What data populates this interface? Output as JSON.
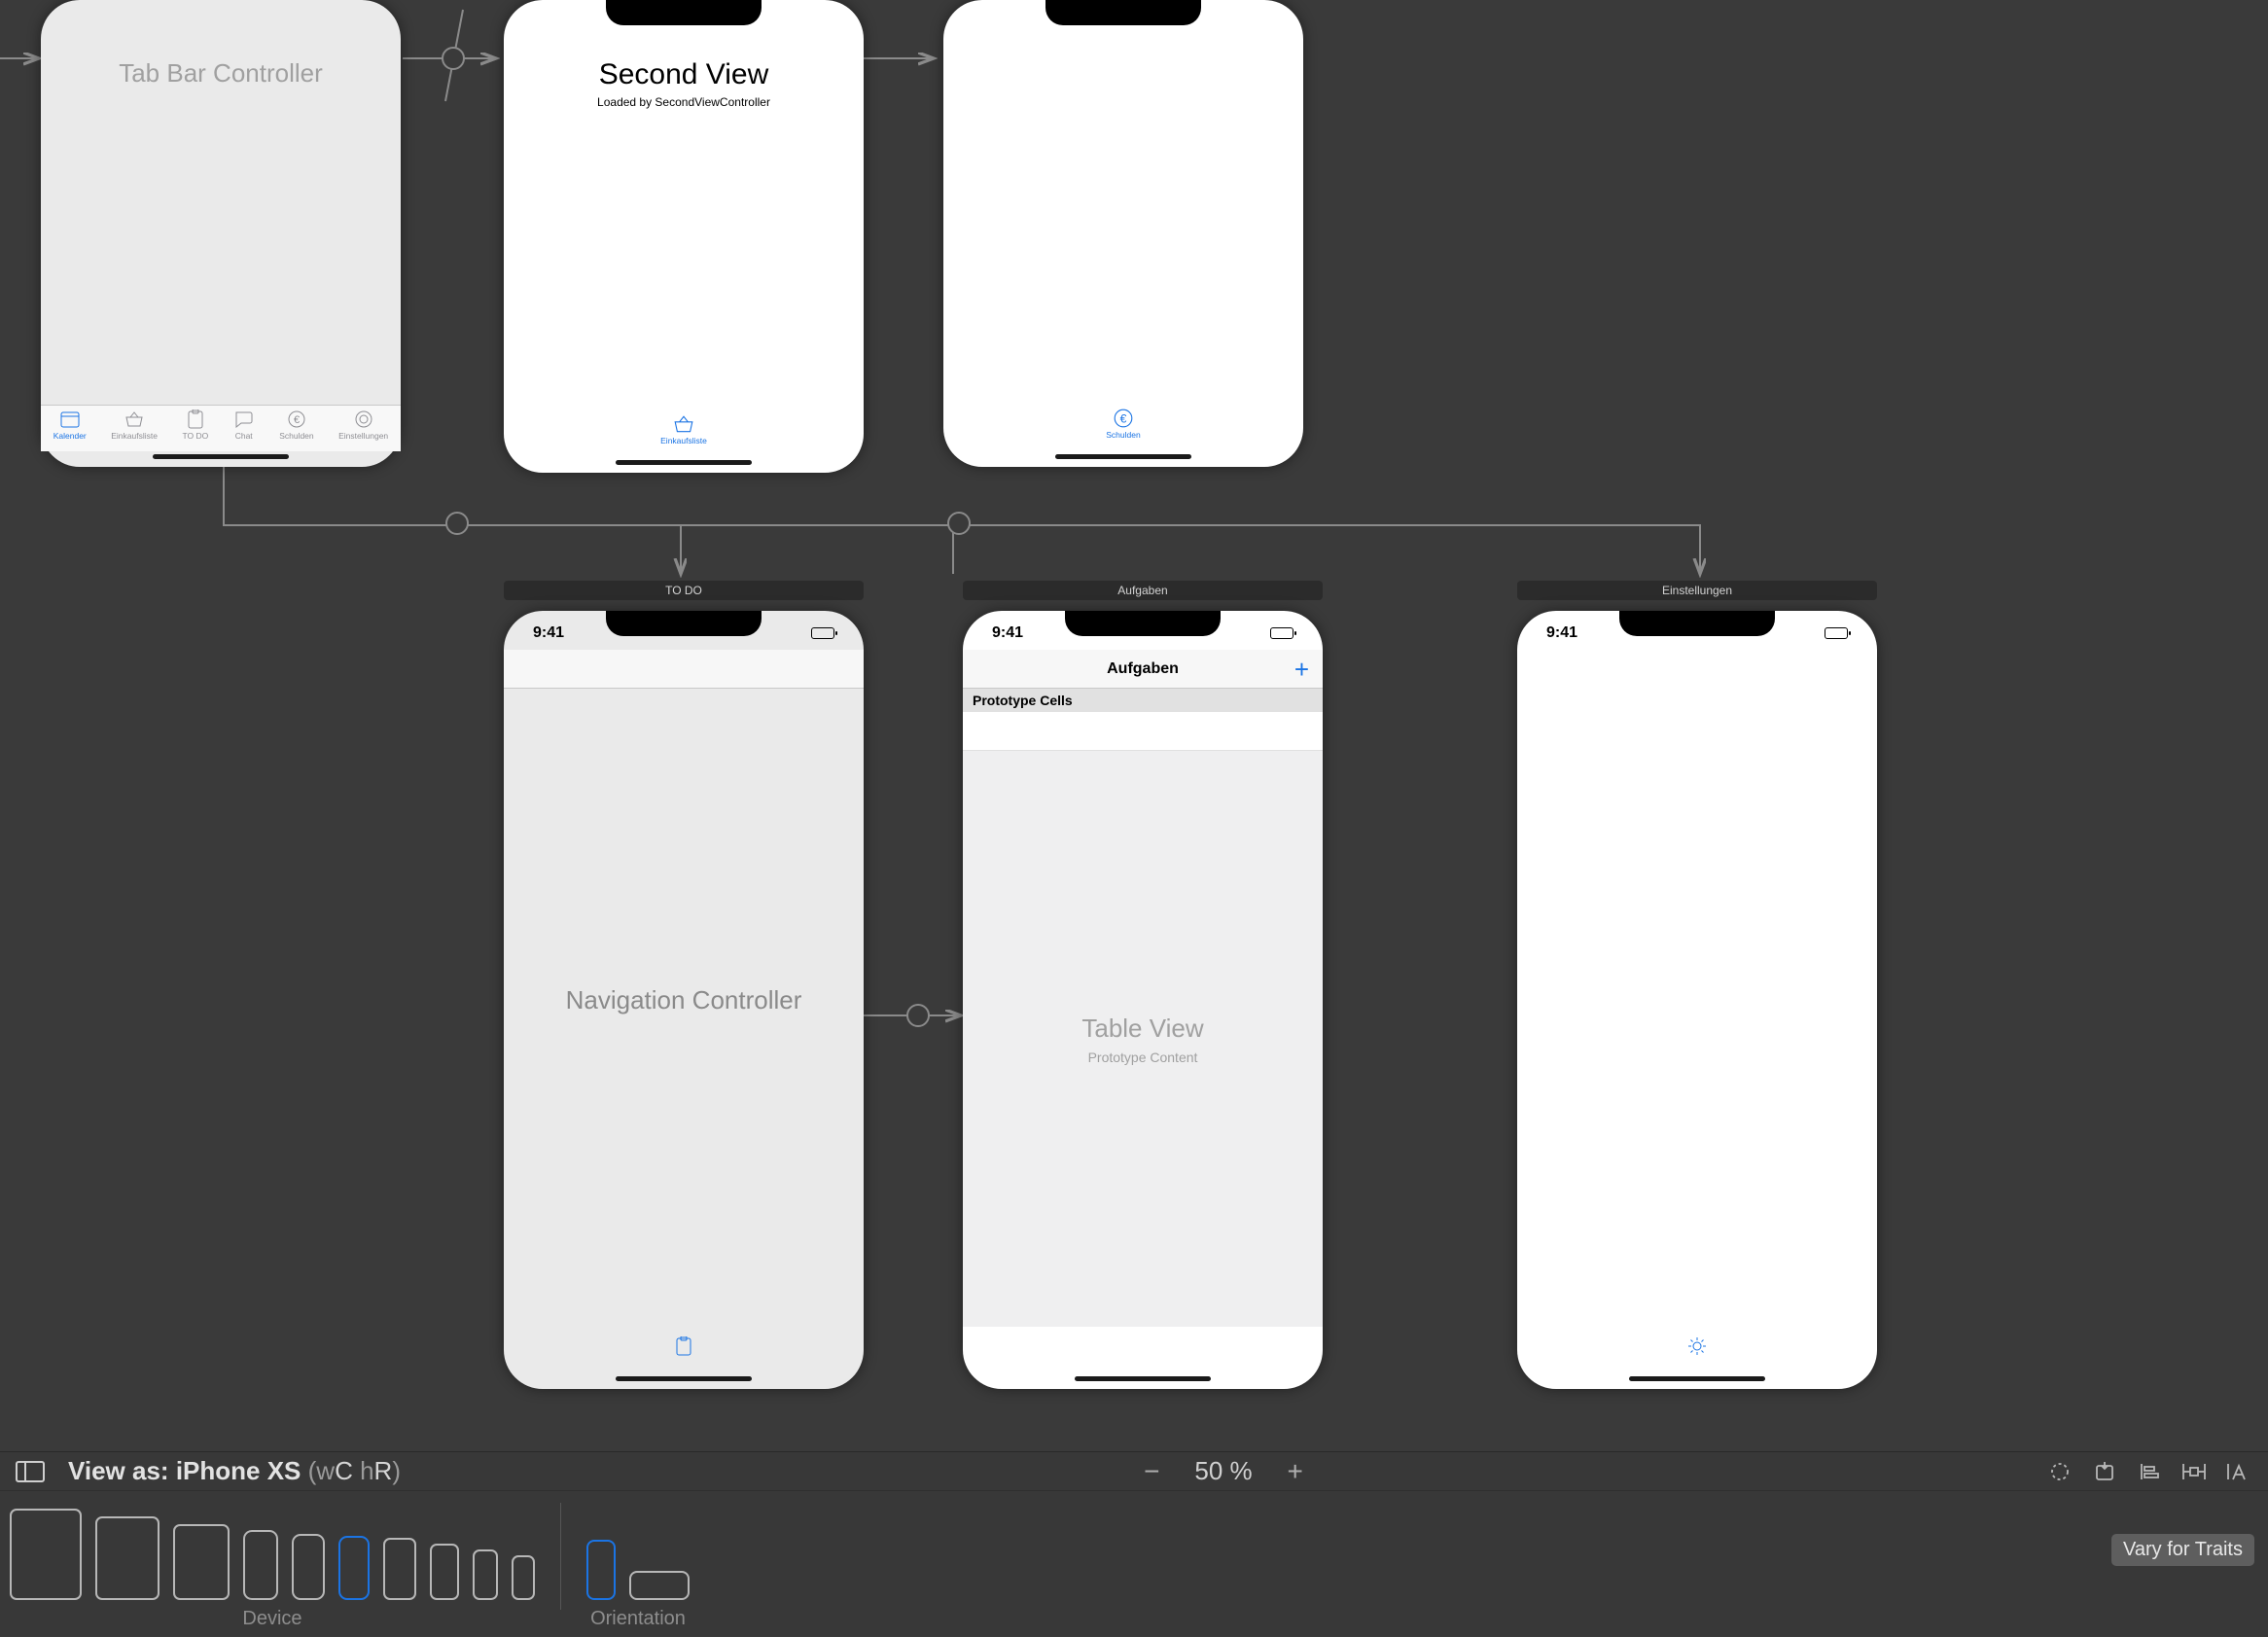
{
  "scenes": {
    "tabbar_controller": {
      "title": "Tab Bar Controller",
      "tabs": [
        {
          "label": "Kalender"
        },
        {
          "label": "Einkaufsliste"
        },
        {
          "label": "TO DO"
        },
        {
          "label": "Chat"
        },
        {
          "label": "Schulden"
        },
        {
          "label": "Einstellungen"
        }
      ]
    },
    "second_view": {
      "title": "Second View",
      "subtitle": "Loaded by SecondViewController",
      "tab_label": "Einkaufsliste"
    },
    "schulden_view": {
      "tab_label": "Schulden"
    },
    "todo_nav": {
      "scene_title": "TO DO",
      "title": "Navigation Controller"
    },
    "aufgaben": {
      "scene_title": "Aufgaben",
      "status_time": "9:41",
      "nav_title": "Aufgaben",
      "proto_header": "Prototype Cells",
      "table_title": "Table View",
      "table_subtitle": "Prototype Content"
    },
    "einstellungen": {
      "scene_title": "Einstellungen",
      "status_time": "9:41"
    },
    "shared_status_time": "9:41"
  },
  "bottombar": {
    "view_as_prefix": "View as: ",
    "view_as_device": "iPhone XS",
    "traits_wc": "w",
    "traits_C": "C ",
    "traits_h": "h",
    "traits_R": "R",
    "zoom_label": "50 %",
    "device_label": "Device",
    "orientation_label": "Orientation",
    "vary_button": "Vary for Traits"
  }
}
